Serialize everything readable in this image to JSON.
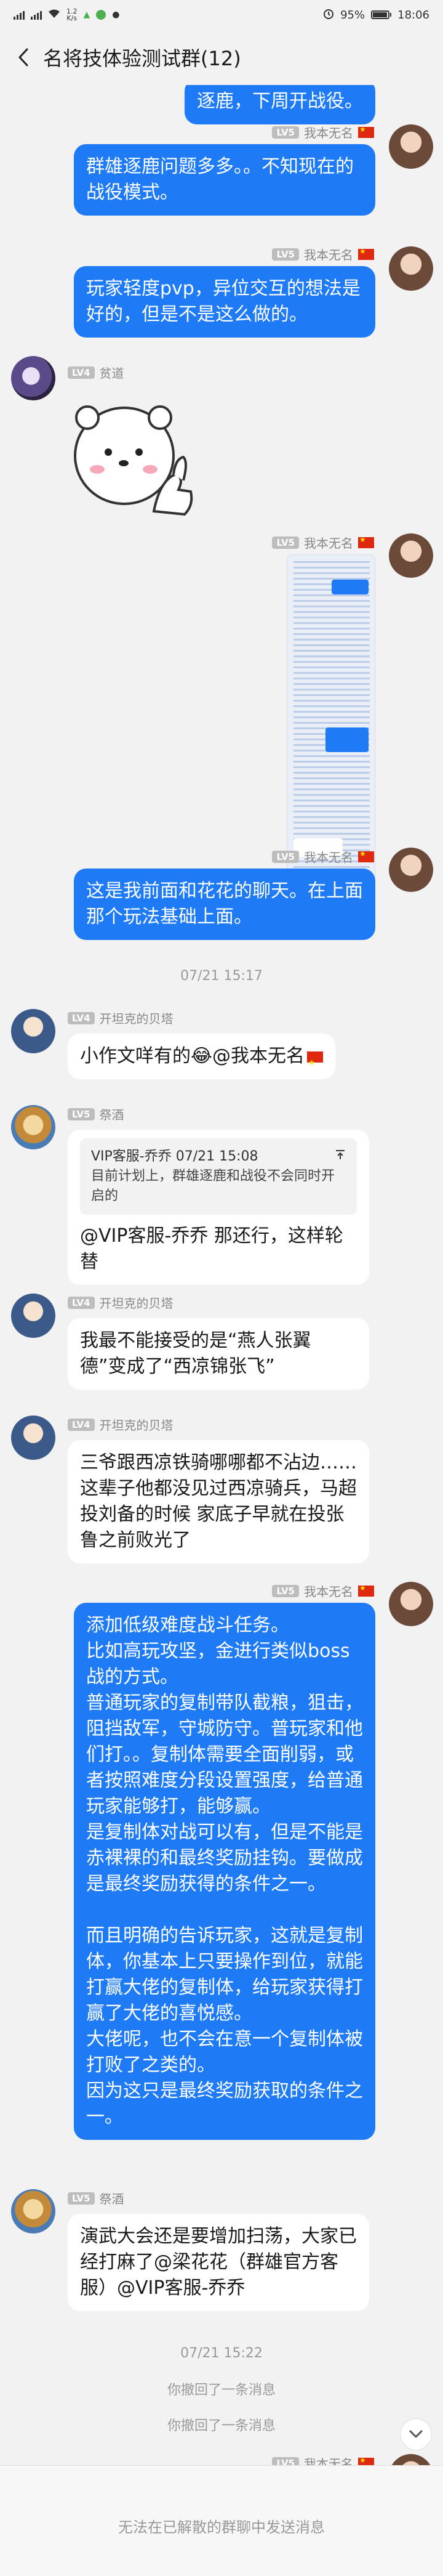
{
  "status_bar": {
    "carrier_left": "",
    "speed": "1.2",
    "speed_unit": "K/s",
    "battery": "95%",
    "battery_level": 0.95,
    "time": "18:06"
  },
  "nav": {
    "title": "名将技体验测试群(12)"
  },
  "chat": {
    "partial_top_text": "逐鹿，下周开战役。",
    "messages": [
      {
        "side": "right",
        "sender": "我本无名",
        "level": "LV5",
        "text": "群雄逐鹿问题多多。。不知现在的战役模式。"
      },
      {
        "side": "right",
        "sender": "我本无名",
        "level": "LV5",
        "text": "玩家轻度pvp，异位交互的想法是好的，但是不是这么做的。"
      },
      {
        "side": "left",
        "sender": "贫道",
        "level": "LV4",
        "sticker": "bear-thumbs-up"
      },
      {
        "side": "right",
        "sender": "我本无名",
        "level": "LV5",
        "image": "long-screenshot"
      },
      {
        "side": "right",
        "sender": "我本无名",
        "level": "LV5",
        "text": "这是我前面和花花的聊天。在上面那个玩法基础上面。"
      }
    ],
    "time1": "07/21 15:17",
    "msg_tank1": {
      "sender": "开坦克的贝塔",
      "level": "LV4",
      "text": "小作文咩有的😂@我本无名"
    },
    "msg_jiu1": {
      "sender": "祭酒",
      "level": "LV5",
      "quote_head": "VIP客服-乔乔 07/21 15:08",
      "quote_text": "目前计划上，群雄逐鹿和战役不会同时开启的",
      "text": "@VIP客服-乔乔 那还行，这样轮替"
    },
    "msg_tank2": {
      "sender": "开坦克的贝塔",
      "level": "LV4",
      "text": "我最不能接受的是“燕人张翼德”变成了“西凉锦张飞”"
    },
    "msg_tank3": {
      "sender": "开坦克的贝塔",
      "level": "LV4",
      "text": "三爷跟西凉铁骑哪哪都不沾边……这辈子他都没见过西凉骑兵，马超投刘备的时候 家底子早就在投张鲁之前败光了"
    },
    "msg_long": {
      "sender": "我本无名",
      "level": "LV5",
      "lines": [
        "添加低级难度战斗任务。",
        "比如高玩攻坚，金进行类似boss战的方式。",
        "普通玩家的复制带队截粮，狙击，阻挡敌军，守城防守。普玩家和他们打。。复制体需要全面削弱，或者按照难度分段设置强度，给普通玩家能够打，能够赢。",
        "是复制体对战可以有，但是不能是赤裸裸的和最终奖励挂钩。要做成是最终奖励获得的条件之一。",
        "",
        "而且明确的告诉玩家，这就是复制体，你基本上只要操作到位，就能打赢大佬的复制体，给玩家获得打赢了大佬的喜悦感。",
        "大佬呢，也不会在意一个复制体被打败了之类的。",
        "因为这只是最终奖励获取的条件之一。"
      ]
    },
    "msg_jiu2": {
      "sender": "祭酒",
      "level": "LV5",
      "text": "演武大会还是要增加扫荡，大家已经打麻了@梁花花（群雄官方客服）@VIP客服-乔乔"
    },
    "time2": "07/21 15:22",
    "sys1": "你撤回了一条消息",
    "sys2": "你撤回了一条消息",
    "bottom_partial_sender": "我本无名"
  },
  "footer": {
    "text": "无法在已解散的群聊中发送消息"
  }
}
